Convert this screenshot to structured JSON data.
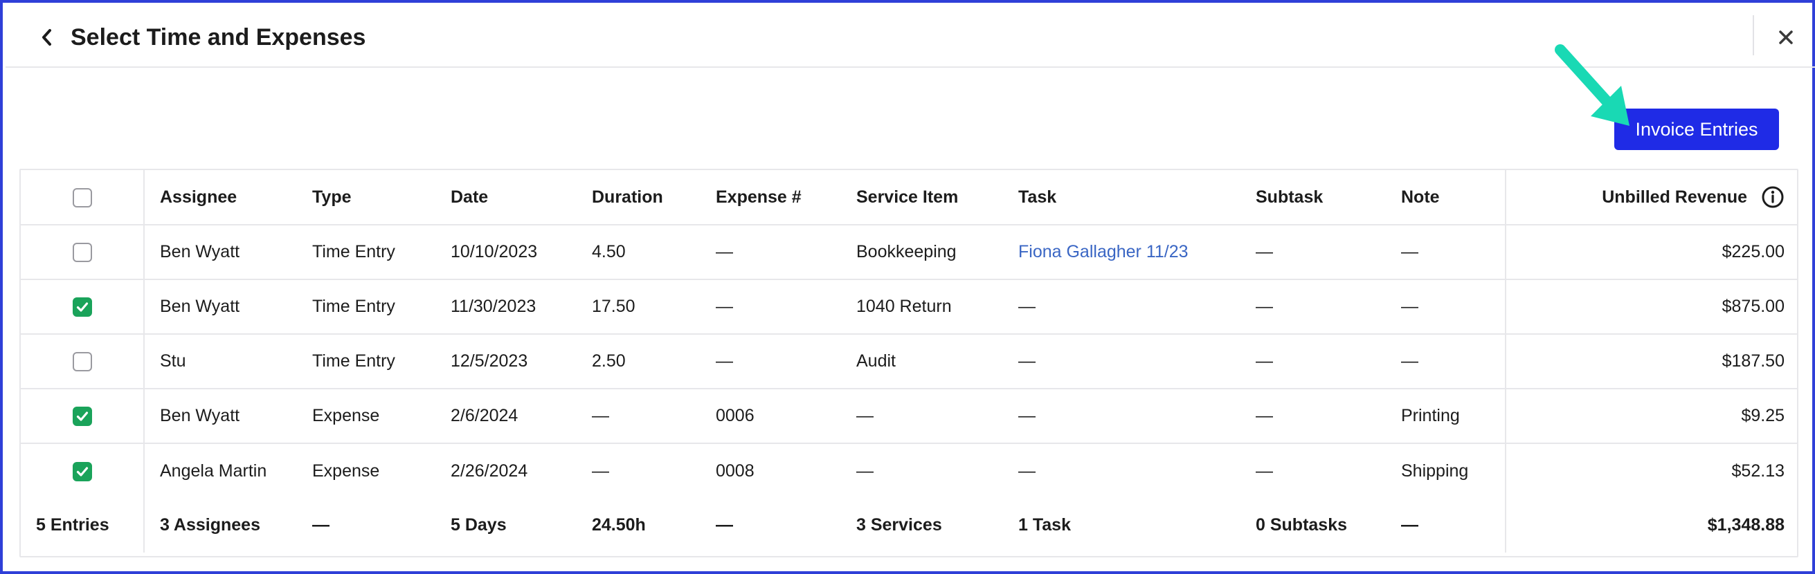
{
  "header": {
    "title": "Select Time and Expenses",
    "back_icon": "chevron-left-icon",
    "close_icon": "close-icon"
  },
  "actions": {
    "invoice_label": "Invoice Entries",
    "accent_color": "#1f2be6",
    "arrow_color": "#19d9b4"
  },
  "table": {
    "columns": [
      "Assignee",
      "Type",
      "Date",
      "Duration",
      "Expense #",
      "Service Item",
      "Task",
      "Subtask",
      "Note",
      "Unbilled Revenue"
    ],
    "rows": [
      {
        "checked": false,
        "assignee": "Ben Wyatt",
        "type": "Time Entry",
        "date": "10/10/2023",
        "duration": "4.50",
        "expense": "—",
        "service": "Bookkeeping",
        "task": "Fiona Gallagher 11/23",
        "task_is_link": true,
        "subtask": "—",
        "note": "—",
        "revenue": "$225.00"
      },
      {
        "checked": true,
        "assignee": "Ben Wyatt",
        "type": "Time Entry",
        "date": "11/30/2023",
        "duration": "17.50",
        "expense": "—",
        "service": "1040 Return",
        "task": "—",
        "task_is_link": false,
        "subtask": "—",
        "note": "—",
        "revenue": "$875.00"
      },
      {
        "checked": false,
        "assignee": "Stu",
        "type": "Time Entry",
        "date": "12/5/2023",
        "duration": "2.50",
        "expense": "—",
        "service": "Audit",
        "task": "—",
        "task_is_link": false,
        "subtask": "—",
        "note": "—",
        "revenue": "$187.50"
      },
      {
        "checked": true,
        "assignee": "Ben Wyatt",
        "type": "Expense",
        "date": "2/6/2024",
        "duration": "—",
        "expense": "0006",
        "service": "—",
        "task": "—",
        "task_is_link": false,
        "subtask": "—",
        "note": "Printing",
        "revenue": "$9.25"
      },
      {
        "checked": true,
        "assignee": "Angela Martin",
        "type": "Expense",
        "date": "2/26/2024",
        "duration": "—",
        "expense": "0008",
        "service": "—",
        "task": "—",
        "task_is_link": false,
        "subtask": "—",
        "note": "Shipping",
        "revenue": "$52.13"
      }
    ],
    "totals": {
      "entries": "5 Entries",
      "assignees": "3 Assignees",
      "type": "—",
      "date": "5 Days",
      "duration": "24.50h",
      "expense": "—",
      "service": "3 Services",
      "task": "1 Task",
      "subtask": "0 Subtasks",
      "note": "—",
      "revenue": "$1,348.88"
    },
    "checked_color": "#1aa35a",
    "link_color": "#3a66c4"
  }
}
